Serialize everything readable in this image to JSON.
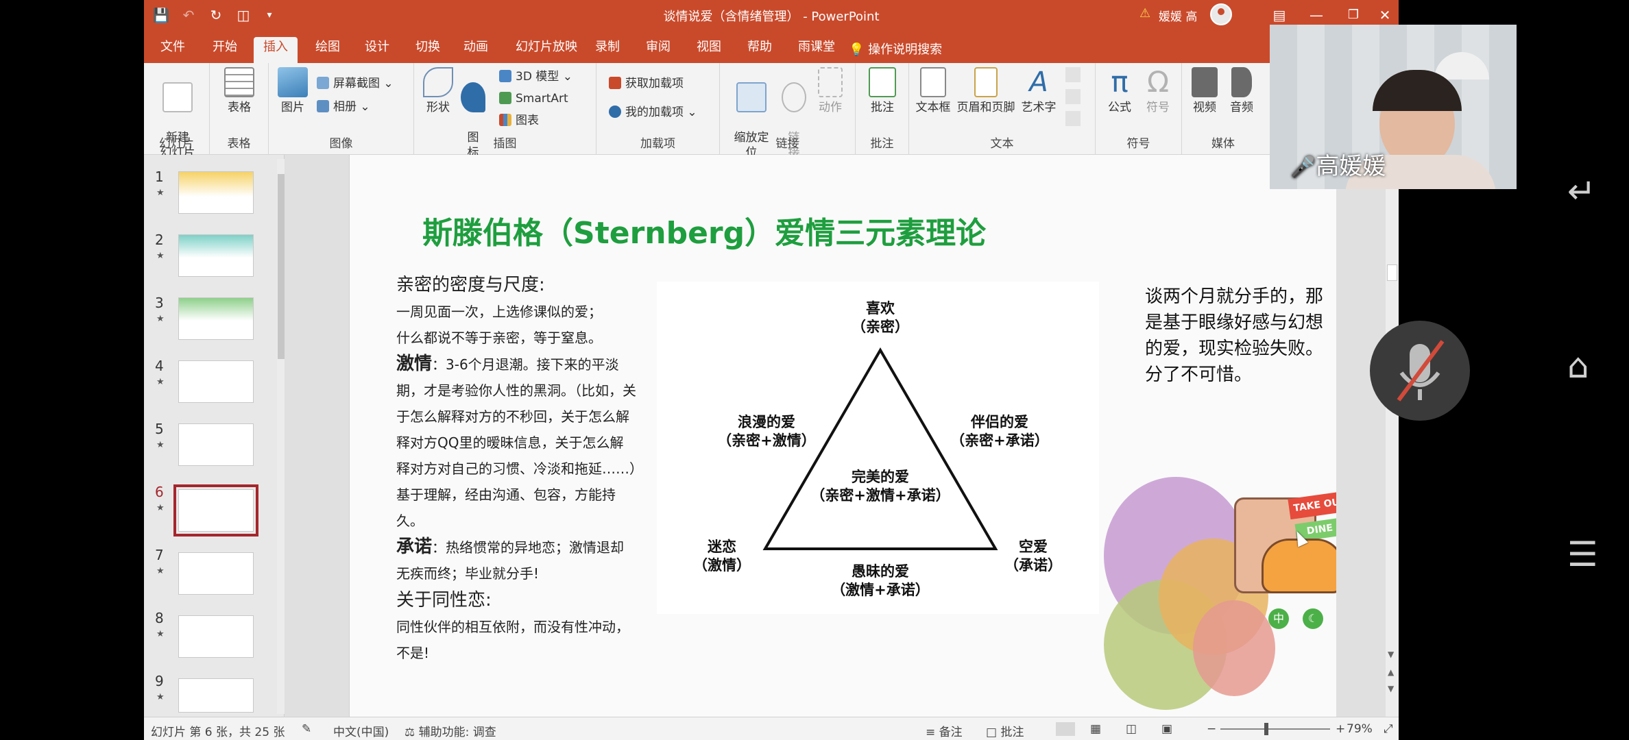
{
  "window": {
    "title": "谈情说爱（含情绪管理） - PowerPoint",
    "user": "媛媛 高"
  },
  "tabs": [
    "文件",
    "开始",
    "插入",
    "绘图",
    "设计",
    "切换",
    "动画",
    "幻灯片放映",
    "录制",
    "审阅",
    "视图",
    "帮助",
    "雨课堂"
  ],
  "active_tab": "插入",
  "tell_me": "操作说明搜索",
  "ribbon": {
    "groups": {
      "slides": "幻灯片",
      "tables": "表格",
      "images": "图像",
      "illustrations": "插图",
      "addins": "加载项",
      "links": "链接",
      "comments": "批注",
      "text": "文本",
      "symbols": "符号",
      "media": "媒体"
    },
    "buttons": {
      "new_slide": "新建\n幻灯片",
      "table": "表格",
      "picture": "图片",
      "screenshot": "屏幕截图",
      "album": "相册",
      "shapes": "形状",
      "icons": "图\n标",
      "model3d": "3D 模型",
      "smartart": "SmartArt",
      "chart": "图表",
      "get_addins": "获取加载项",
      "my_addins": "我的加载项",
      "zoom": "缩放定\n位",
      "link": "链\n接",
      "action": "动作",
      "comment": "批注",
      "textbox": "文本框",
      "header_footer": "页眉和页脚",
      "wordart": "艺术字",
      "equation": "公式",
      "symbol": "符号",
      "video": "视频",
      "audio": "音频"
    }
  },
  "thumbnails": [
    "1",
    "2",
    "3",
    "4",
    "5",
    "6",
    "7",
    "8",
    "9"
  ],
  "active_thumbnail": "6",
  "slide": {
    "title": "斯滕伯格（Sternberg）爱情三元素理论",
    "left": {
      "h1": "亲密的密度与尺度:",
      "p1": "一周见面一次，上选修课似的爱；",
      "p2": "什么都说不等于亲密，等于窒息。",
      "h2": "激情",
      "p3": "：3-6个月退潮。接下来的平淡期，才是考验你人性的黑洞。（比如，关于怎么解释对方的不秒回，关于怎么解释对方QQ里的暧昧信息，关于怎么解释对方对自己的习惯、冷淡和拖延……）基于理解，经由沟通、包容，方能持久。",
      "h3": "承诺",
      "p4": "：热络惯常的异地恋；激情退却无疾而终；毕业就分手!",
      "h4": "关于同性恋:",
      "p5": "同性伙伴的相互依附，而没有性冲动，不是!"
    },
    "triangle": {
      "top": "喜欢\n（亲密）",
      "upper_left": "浪漫的爱\n（亲密+激情）",
      "upper_right": "伴侣的爱\n（亲密+承诺）",
      "center": "完美的爱\n（亲密+激情+承诺）",
      "bottom_left": "迷恋\n（激情）",
      "bottom_right": "空爱\n（承诺）",
      "bottom": "愚昧的爱\n（激情+承诺）"
    },
    "right_note": "谈两个月就分手的，那是基于眼缘好感与幻想的爱，现实检验失败。分了不可惜。",
    "sticker": {
      "takeout": "TAKE OUT",
      "dine": "DINE",
      "zh": "中"
    }
  },
  "status": {
    "slide_info": "幻灯片 第 6 张，共 25 张",
    "language": "中文(中国)",
    "accessibility": "辅助功能: 调查",
    "notes": "备注",
    "comments": "批注",
    "zoom": "79%"
  },
  "webcam": {
    "name": "高媛媛"
  }
}
